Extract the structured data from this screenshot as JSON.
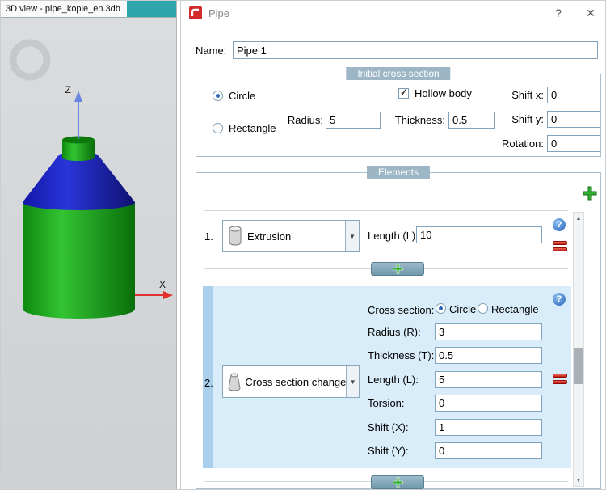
{
  "left_panel": {
    "title": "3D view - pipe_kopie_en.3db",
    "axis_z": "Z",
    "axis_x": "X"
  },
  "dialog": {
    "title": "Pipe",
    "help_label": "?",
    "close_label": "✕",
    "name_label": "Name:",
    "name_value": "Pipe 1"
  },
  "initial": {
    "title": "Initial cross section",
    "circle": "Circle",
    "rectangle": "Rectangle",
    "radius_label": "Radius:",
    "radius": "5",
    "hollow": "Hollow body",
    "thickness_label": "Thickness:",
    "thickness": "0.5",
    "shift_x_label": "Shift x:",
    "shift_x": "0",
    "shift_y_label": "Shift y:",
    "shift_y": "0",
    "rotation_label": "Rotation:",
    "rotation": "0"
  },
  "elements": {
    "title": "Elements",
    "item1": {
      "index": "1.",
      "type": "Extrusion",
      "length_label": "Length (L):",
      "length": "10"
    },
    "item2": {
      "index": "2.",
      "type": "Cross section change",
      "cross_section_label": "Cross section:",
      "circle": "Circle",
      "rectangle": "Rectangle",
      "radius_label": "Radius (R):",
      "radius": "3",
      "thickness_label": "Thickness (T):",
      "thickness": "0.5",
      "length_label": "Length (L):",
      "length": "5",
      "torsion_label": "Torsion:",
      "torsion": "0",
      "shift_x_label": "Shift (X):",
      "shift_x": "1",
      "shift_y_label": "Shift (Y):",
      "shift_y": "0"
    }
  },
  "icons": {
    "dropdown": "▼",
    "scroll_up": "▲",
    "scroll_down": "▼",
    "check": "✓"
  },
  "colors": {
    "accent_teal": "#2da5ab",
    "group_header": "#9db6c6",
    "selection_bg": "#d9ecfa",
    "selection_bar": "#a9cfec",
    "add_green": "#2fae2f",
    "remove_red": "#c41b10",
    "help_blue": "#2a63b8",
    "cylinder_green": "#1ea31e",
    "cone_blue": "#1c27c0",
    "axis_x_red": "#e03030",
    "axis_z_blue": "#6b86e0"
  }
}
